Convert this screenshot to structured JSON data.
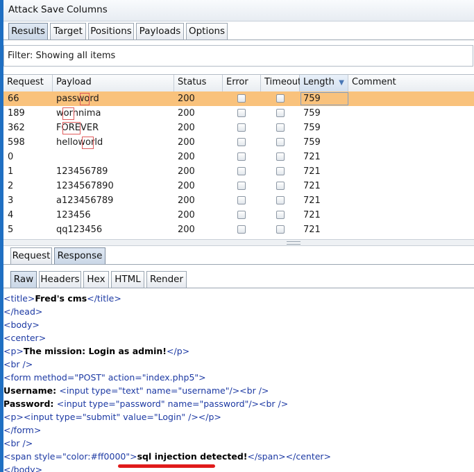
{
  "menu": [
    "Attack",
    "Save",
    "Columns"
  ],
  "main_tabs": [
    "Results",
    "Target",
    "Positions",
    "Payloads",
    "Options"
  ],
  "filter_text": "Filter: Showing all items",
  "table": {
    "columns": [
      "Request",
      "Payload",
      "Status",
      "Error",
      "Timeout",
      "Length",
      "Comment"
    ],
    "sorted_column": "Length",
    "rows": [
      {
        "request": "66",
        "payload": "password",
        "status": "200",
        "length": "759",
        "selected": true
      },
      {
        "request": "189",
        "payload": "wornnima",
        "status": "200",
        "length": "759"
      },
      {
        "request": "362",
        "payload": "FOREVER",
        "status": "200",
        "length": "759"
      },
      {
        "request": "598",
        "payload": "helloworld",
        "status": "200",
        "length": "759"
      },
      {
        "request": "0",
        "payload": "",
        "status": "200",
        "length": "721"
      },
      {
        "request": "1",
        "payload": "123456789",
        "status": "200",
        "length": "721"
      },
      {
        "request": "2",
        "payload": "1234567890",
        "status": "200",
        "length": "721"
      },
      {
        "request": "3",
        "payload": "a123456789",
        "status": "200",
        "length": "721"
      },
      {
        "request": "4",
        "payload": "123456",
        "status": "200",
        "length": "721"
      },
      {
        "request": "5",
        "payload": "qq123456",
        "status": "200",
        "length": "721"
      }
    ]
  },
  "message_tabs": [
    "Request",
    "Response"
  ],
  "view_tabs": [
    "Raw",
    "Headers",
    "Hex",
    "HTML",
    "Render"
  ],
  "response_lines": [
    [
      [
        "tag",
        "<title>"
      ],
      [
        "txt",
        "Fred's cms"
      ],
      [
        "tag",
        "</title>"
      ]
    ],
    [
      [
        "tag",
        "</head>"
      ]
    ],
    [
      [
        "tag",
        "<body>"
      ]
    ],
    [
      [
        "tag",
        "<center>"
      ]
    ],
    [
      [
        "tag",
        "<p>"
      ],
      [
        "txt",
        "The mission: Login as admin!"
      ],
      [
        "tag",
        "</p>"
      ]
    ],
    [
      [
        "tag",
        "<br />"
      ]
    ],
    [
      [
        "tag",
        "<form method="
      ],
      [
        "val",
        "\"POST\""
      ],
      [
        "tag",
        " action="
      ],
      [
        "val",
        "\"index.php5\""
      ],
      [
        "tag",
        ">"
      ]
    ],
    [
      [
        "txt",
        "Username: "
      ],
      [
        "tag",
        "<input type="
      ],
      [
        "val",
        "\"text\""
      ],
      [
        "tag",
        " name="
      ],
      [
        "val",
        "\"username\""
      ],
      [
        "tag",
        "/><br />"
      ]
    ],
    [
      [
        "txt",
        "Password: "
      ],
      [
        "tag",
        "<input type="
      ],
      [
        "val",
        "\"password\""
      ],
      [
        "tag",
        " name="
      ],
      [
        "val",
        "\"password\""
      ],
      [
        "tag",
        "/><br />"
      ]
    ],
    [
      [
        "tag",
        "<p><input type="
      ],
      [
        "val",
        "\"submit\""
      ],
      [
        "tag",
        " value="
      ],
      [
        "val",
        "\"Login\""
      ],
      [
        "tag",
        " /></p>"
      ]
    ],
    [
      [
        "tag",
        "</form>"
      ]
    ],
    [
      [
        "tag",
        "<br />"
      ]
    ],
    [
      [
        "tag",
        "<span style="
      ],
      [
        "val",
        "\"color:#ff0000\""
      ],
      [
        "tag",
        ">"
      ],
      [
        "txt",
        "sql injection detected!"
      ],
      [
        "tag",
        "</span></center>"
      ]
    ],
    [
      [
        "tag",
        "</body>"
      ]
    ]
  ],
  "colors": {
    "selected_row": "#f9c27c",
    "accent": "#1f6fc2",
    "highlight_underline": "#e01b1b"
  }
}
